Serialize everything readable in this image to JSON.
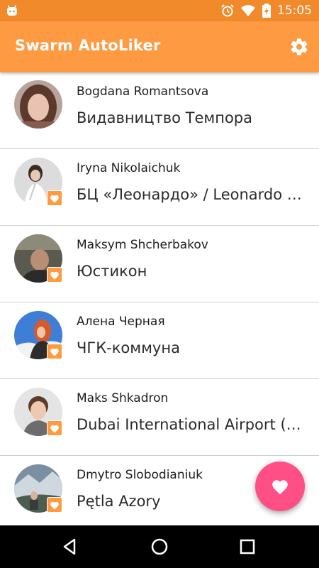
{
  "status_bar": {
    "time": "15:05",
    "icons": [
      "android-icon",
      "alarm-icon",
      "wifi-icon",
      "battery-charging-icon"
    ]
  },
  "app_bar": {
    "title": "Swarm AutoLiker",
    "settings_icon": "gear-icon"
  },
  "checkins": [
    {
      "name": "Bogdana Romantsova",
      "venue": "Видавництво Темпора",
      "liked": false
    },
    {
      "name": "Iryna Nikolaichuk",
      "venue": "БЦ «Леонардо» / Leonardo Business Center",
      "liked": true
    },
    {
      "name": "Maksym Shcherbakov",
      "venue": "Юстикон",
      "liked": true
    },
    {
      "name": "Алена Черная",
      "venue": "ЧГК-коммуна",
      "liked": true
    },
    {
      "name": "Maks Shkadron",
      "venue": "Dubai International Airport (DXB)",
      "liked": true
    },
    {
      "name": "Dmytro Slobodianiuk",
      "venue": "Pętla Azory",
      "liked": true
    }
  ],
  "fab": {
    "icon": "heart-icon"
  },
  "nav_bar": {
    "icons": [
      "back-icon",
      "home-icon",
      "recents-icon"
    ]
  },
  "colors": {
    "status_bar": "#f08a2b",
    "app_bar": "#fe9a42",
    "fab": "#ff4f86",
    "badge": "#fe9a42",
    "divider": "#cfcfcf",
    "nav_bar": "#000000"
  }
}
